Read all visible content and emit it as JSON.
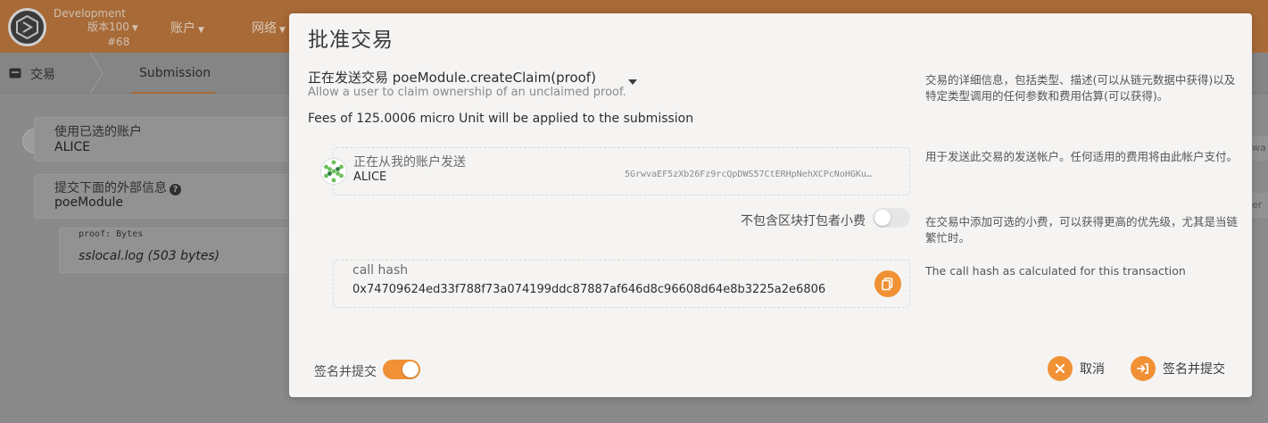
{
  "app": {
    "chain_name": "Development",
    "version": "版本100",
    "block": "#68",
    "nav": [
      {
        "label": "账户"
      },
      {
        "label": "网络"
      }
    ]
  },
  "subnav": {
    "tx_label": "交易",
    "submission_label": "Submission"
  },
  "background_form": {
    "account_label": "使用已选的账户",
    "account_value": "ALICE",
    "extrinsic_label": "提交下面的外部信息",
    "extrinsic_value": "poeModule",
    "param_label": "proof: Bytes",
    "param_value": "sslocal.log (503 bytes)",
    "right_edge_1": "wa",
    "right_edge_2": "er"
  },
  "modal": {
    "title": "批准交易",
    "call_title": "正在发送交易 poeModule.createClaim(proof)",
    "call_description": "Allow a user to claim ownership of an unclaimed proof.",
    "fees": "Fees of 125.0006 micro Unit will be applied to the submission",
    "help_call": "交易的详细信息，包括类型、描述(可以从链元数据中获得)以及特定类型调用的任何参数和费用估算(可以获得)。",
    "sender": {
      "label": "正在从我的账户发送",
      "name": "ALICE",
      "address": "5GrwvaEF5zXb26Fz9rcQpDWS57CtERHpNehXCPcNoHGKu…",
      "help": "用于发送此交易的发送帐户。任何适用的费用将由此帐户支付。"
    },
    "tip": {
      "label": "不包含区块打包者小费",
      "enabled": false,
      "help": "在交易中添加可选的小费，可以获得更高的优先级，尤其是当链繁忙时。"
    },
    "call_hash": {
      "label": "call hash",
      "value": "0x74709624ed33f788f73a074199ddc87887af646d8c96608d64e8b3225a2e6806",
      "help": "The call hash as calculated for this transaction"
    },
    "sign_toggle": {
      "label": "签名并提交",
      "enabled": true
    },
    "buttons": {
      "cancel": "取消",
      "sign_submit": "签名并提交"
    }
  },
  "colors": {
    "accent": "#f19135",
    "header": "#a86a37"
  }
}
